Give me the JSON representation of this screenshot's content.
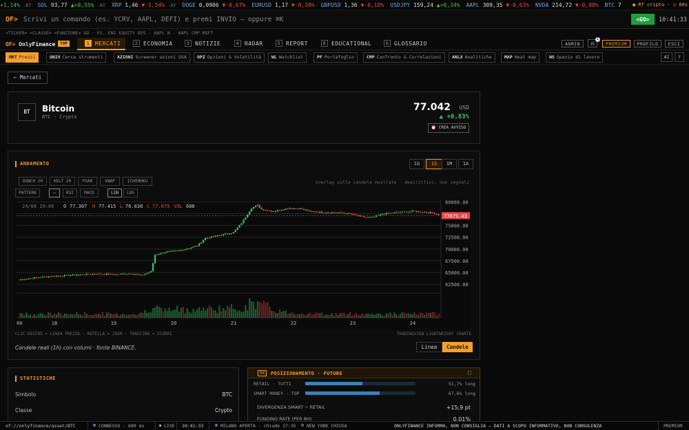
{
  "ticker": [
    {
      "sym": "",
      "price": "",
      "chg": "+1,14%",
      "dir": "up",
      "tag": "-RT"
    },
    {
      "sym": "SOL",
      "price": "93,77",
      "chg": "▲+0,55%",
      "dir": "up",
      "tag": "-RT"
    },
    {
      "sym": "XRP",
      "price": "1,46",
      "chg": "▼-1,54%",
      "dir": "dn",
      "tag": "-RT"
    },
    {
      "sym": "DOGE",
      "price": "0,0906",
      "chg": "▼-0,67%",
      "dir": "dn",
      "tag": ""
    },
    {
      "sym": "EURUSD",
      "price": "1,17",
      "chg": "▼-0,30%",
      "dir": "dn",
      "tag": ""
    },
    {
      "sym": "GBPUSD",
      "price": "1,36",
      "chg": "▼-0,18%",
      "dir": "dn",
      "tag": ""
    },
    {
      "sym": "USDJPY",
      "price": "159,24",
      "chg": "▲+0,34%",
      "dir": "up",
      "tag": ""
    },
    {
      "sym": "AAPL",
      "price": "309,35",
      "chg": "▼-0,63%",
      "dir": "dn",
      "tag": ""
    },
    {
      "sym": "NVDA",
      "price": "214,72",
      "chg": "▼-0,98%",
      "dir": "dn",
      "tag": ""
    },
    {
      "sym": "BTC",
      "price": "7",
      "chg": "",
      "dir": "",
      "tag": ""
    }
  ],
  "ticker_status": "● RT cripto · ○ 60s",
  "command": {
    "prefix": "OF>",
    "placeholder": "Scrivi un comando (es. YCRV, AAPL, DEFI) e premi INVIO — oppure ⌘K",
    "go": "<GO>",
    "clock": "10:41:33"
  },
  "syntax_hint": "<TICKER> <CLASSE> <FUNZIONE> GO · ES. ENI EQUITY DES · AAPL N · AAPL CMP MSFT",
  "logo": {
    "of": "OF>",
    "only": "Only",
    "fin": "Finance",
    "badge": "TOP"
  },
  "nav": [
    {
      "num": "1",
      "label": "MERCATI"
    },
    {
      "num": "2",
      "label": "ECONOMIA"
    },
    {
      "num": "3",
      "label": "NOTIZIE"
    },
    {
      "num": "4",
      "label": "RADAR"
    },
    {
      "num": "5",
      "label": "REPORT"
    },
    {
      "num": "6",
      "label": "EDUCATIONAL"
    },
    {
      "num": "G",
      "label": "GLOSSARIO"
    }
  ],
  "nav_right": {
    "admin": "ADMIN",
    "bell": "⍾",
    "bell_count": "1",
    "premium": "PREMIUM",
    "profile": "PROFILO",
    "exit": "ESCI"
  },
  "subnav": [
    {
      "code": "MKT",
      "label": "Prezzi"
    },
    {
      "code": "UNIV",
      "label": "Cerca strumenti"
    },
    {
      "code": "AZIONI",
      "label": "Screener azioni USA"
    },
    {
      "code": "OPZ",
      "label": "Opzioni & Volatilità"
    },
    {
      "code": "WL",
      "label": "Watchlist"
    },
    {
      "code": "PF",
      "label": "Portafoglio"
    },
    {
      "code": "CMP",
      "label": "Confronto & Correlazioni"
    },
    {
      "code": "ANLX",
      "label": "Analitiche"
    },
    {
      "code": "MAP",
      "label": "Heat map"
    },
    {
      "code": "WS",
      "label": "Spazio di lavoro"
    }
  ],
  "subnav_right": {
    "ai": "AI",
    "help": "?"
  },
  "back": "← Mercati",
  "asset": {
    "avatar": "BT",
    "name": "Bitcoin",
    "sub": "BTC · Crypto",
    "price": "77.042",
    "currency": "USD",
    "change": "▲ +0,83%",
    "alert": "⏰ CREA AVVISO"
  },
  "chart_panel": {
    "title": "ANDAMENTO",
    "timeframes": [
      "1G",
      "1S",
      "1M",
      "1A"
    ],
    "overlays": [
      "DONCH 20",
      "KELT 20",
      "PSAR",
      "VWAP",
      "ICHIMOKU"
    ],
    "studies": [
      "PATTERN",
      "—",
      "RSI",
      "MACD"
    ],
    "scales": [
      "LIN",
      "LOG"
    ],
    "overlay_hint": "overlay sulle candele mostrate · descrittivi, non segnali",
    "footer_left": "CLIC DESTRO = LINEA PREZZO · ROTELLA = ZOOM · TRASCINA = SCORRI",
    "footer_right": "TRADINGVIEW LIGHTWEIGHT CHARTS",
    "caption": "Candele reali (1h) con volumi · fonte BINANCE.",
    "modes": [
      "Linea",
      "Candele"
    ]
  },
  "chart_data": {
    "type": "candlestick",
    "interval": "1h",
    "x_labels": [
      "00",
      "18",
      "19",
      "20",
      "21",
      "22",
      "23",
      "24"
    ],
    "y_ticks": [
      80000,
      77500,
      75000,
      72500,
      70000,
      67500,
      65000,
      62500
    ],
    "y_tick_labels": [
      "80000.00",
      "77500.00",
      "75000.00",
      "72500.00",
      "70000.00",
      "67500.00",
      "65000.00",
      "62500.00"
    ],
    "ylim": [
      61500,
      80500
    ],
    "last_price_label": "77079.43",
    "ohlc_legend": {
      "date": "24/08 10:00",
      "o": "77.307",
      "h": "77.415",
      "l": "76.838",
      "c": "77.079",
      "vol": "688"
    },
    "anchors_close": [
      [
        0,
        63500
      ],
      [
        12,
        64100
      ],
      [
        24,
        64400
      ],
      [
        36,
        64700
      ],
      [
        48,
        64600
      ],
      [
        55,
        64800
      ],
      [
        60,
        64400
      ],
      [
        65,
        65200
      ],
      [
        67,
        68800
      ],
      [
        72,
        69300
      ],
      [
        80,
        69700
      ],
      [
        88,
        70700
      ],
      [
        92,
        72300
      ],
      [
        98,
        72800
      ],
      [
        106,
        73500
      ],
      [
        110,
        75500
      ],
      [
        115,
        78700
      ],
      [
        118,
        79300
      ],
      [
        120,
        78400
      ],
      [
        126,
        78000
      ],
      [
        134,
        78700
      ],
      [
        140,
        78500
      ],
      [
        144,
        78000
      ],
      [
        150,
        77800
      ],
      [
        158,
        77700
      ],
      [
        165,
        77400
      ],
      [
        170,
        76800
      ],
      [
        175,
        76700
      ],
      [
        180,
        77400
      ],
      [
        188,
        77800
      ],
      [
        195,
        78000
      ],
      [
        200,
        77900
      ],
      [
        205,
        77700
      ],
      [
        208,
        77300
      ]
    ],
    "volume_profile": [
      [
        0,
        1
      ],
      [
        60,
        1
      ],
      [
        66,
        3
      ],
      [
        70,
        2
      ],
      [
        110,
        2.5
      ],
      [
        116,
        4
      ],
      [
        130,
        1.5
      ],
      [
        150,
        1
      ],
      [
        208,
        1
      ]
    ]
  },
  "stats": {
    "title": "STATISTICHE",
    "rows": [
      {
        "k": "Simbolo",
        "v": "BTC"
      },
      {
        "k": "Classe",
        "v": "Crypto"
      }
    ]
  },
  "positioning": {
    "num": "04",
    "title": "POSIZIONAMENTO · FUTURE",
    "close": "□",
    "rows": [
      {
        "k": "RETAIL · TUTTI",
        "pct": 0.517,
        "v": "51,7% long"
      },
      {
        "k": "SMART MONEY · TOP",
        "pct": 0.676,
        "v": "67,6% long"
      }
    ],
    "metrics": [
      {
        "k": "DIVERGENZA SMART − RETAIL",
        "v": "+15,9 pt"
      },
      {
        "k": "FUNDING RATE (PER 8H)",
        "v": "0,01%"
      }
    ]
  },
  "status": {
    "url": "of://onlyfinance/asset/BTC",
    "conn": "CONNESSO · 689 ms",
    "live": "LIVE",
    "clock": "10:41:33",
    "market": "MILANO APERTA · chiude 17:35",
    "ny": "NEW YORK CHIUSA",
    "disclaimer": "ONLYFINANCE INFORMA, NON CONSIGLIA — DATI A SCOPO INFORMATIVO, NON CONSULENZA",
    "tier": "PREMIUM"
  },
  "colors": {
    "accent": "#f59f2a",
    "up": "#3ec46d",
    "down": "#e5484d",
    "go": "#1f9f3f",
    "bar": "#3b82b6"
  }
}
